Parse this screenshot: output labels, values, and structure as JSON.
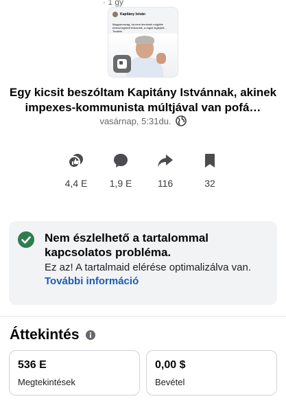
{
  "top_cut_text": "· 1 gy",
  "thumbnail": {
    "author": "Kapitány István",
    "text": "Magyarország, ha nem lennének mögötte elveszhegetett évtizedek, a régiói lögfejlett... További"
  },
  "post": {
    "title": "Egy kicsit beszóltam Kapitány Istvánnak, akinek impexes-kommunista múltjával van pofá…",
    "timestamp": "vasárnap, 5:31du.",
    "reactions": "4,4 E",
    "comments": "1,9 E",
    "shares": "116",
    "saves": "32"
  },
  "status_card": {
    "title": "Nem észlelhető a tartalommal kapcsolatos probléma.",
    "description": "Ez az! A tartalmaid elérése optimalizálva van.",
    "link": "További információ",
    "accent": "#2e7d4f"
  },
  "overview": {
    "title": "Áttekintés",
    "views_value": "536 E",
    "views_label": "Megtekintések",
    "revenue_value": "0,00 $",
    "revenue_label": "Bevétel"
  },
  "icons": [
    "image-icon",
    "globe-icon",
    "reactions-icon",
    "comment-icon",
    "share-icon",
    "bookmark-icon",
    "check-circle-icon",
    "info-icon"
  ]
}
